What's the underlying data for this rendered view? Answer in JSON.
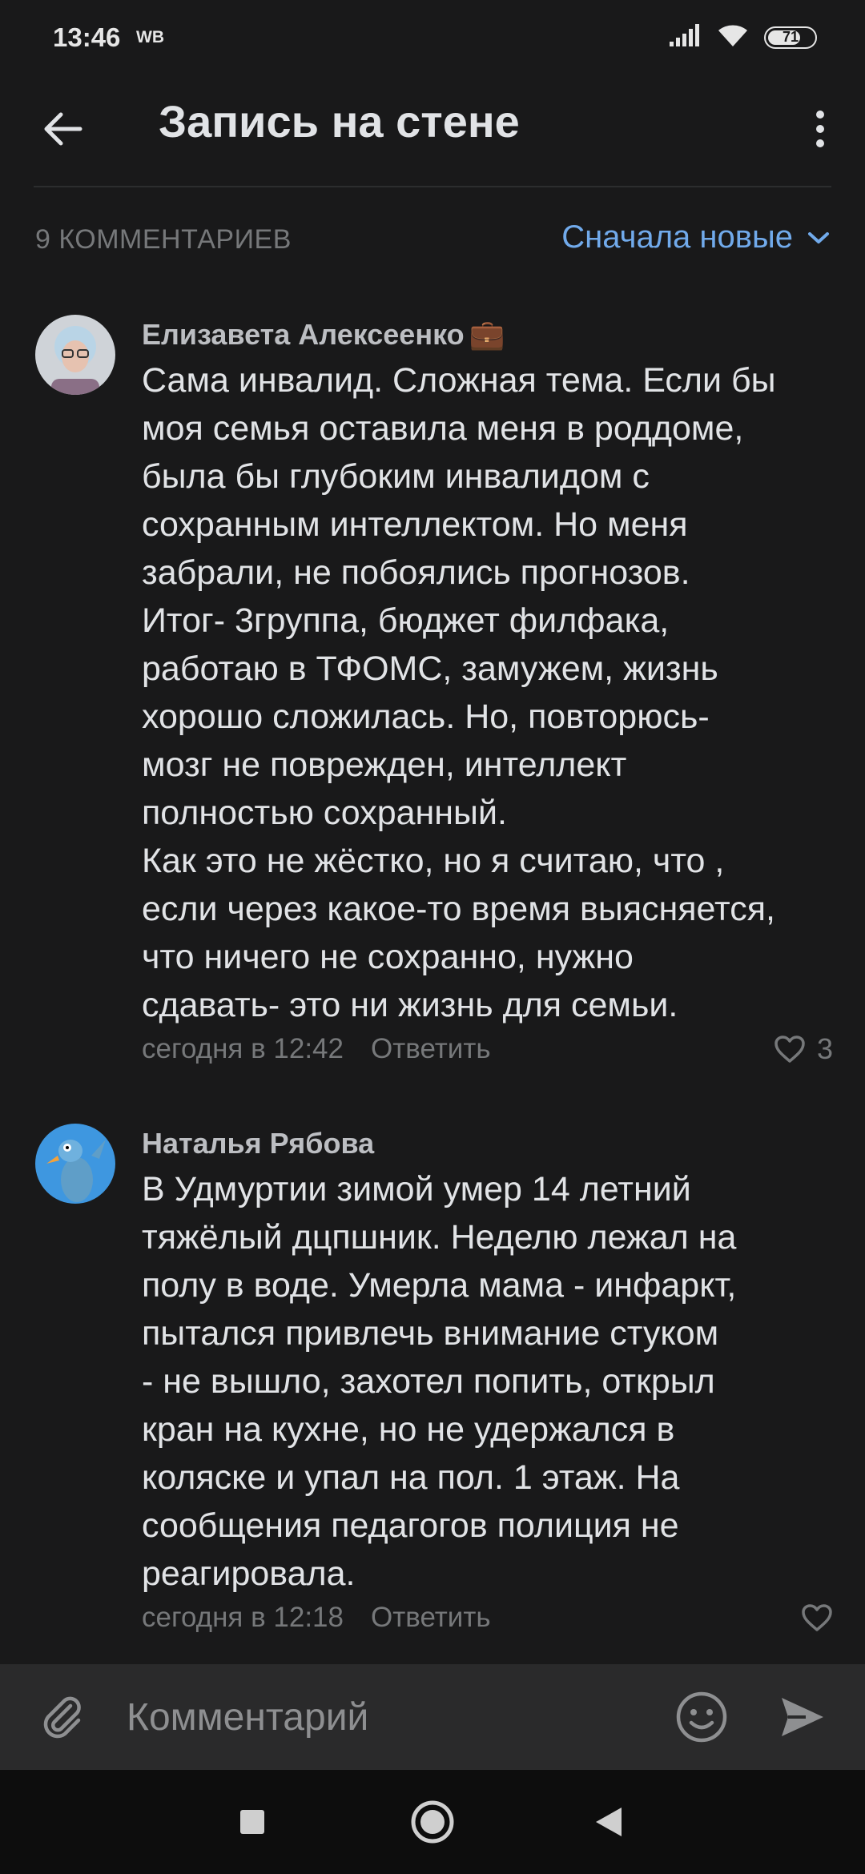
{
  "status_bar": {
    "time": "13:46",
    "carrier": "WB",
    "battery": "71",
    "battery_level": 0.71
  },
  "header": {
    "title": "Запись на стене"
  },
  "comments_bar": {
    "count_label": "9 КОММЕНТАРИЕВ",
    "sort_label": "Сначала новые"
  },
  "comments": [
    {
      "author": "Елизавета Алексеенко",
      "author_badge": "💼",
      "text": "Сама инвалид. Сложная тема. Если бы\nмоя семья оставила меня в роддоме,\nбыла бы глубоким инвалидом с\nсохранным интеллектом. Но меня\nзабрали, не побоялись прогнозов.\nИтог- 3группа, бюджет филфака,\nработаю в ТФОМС, замужем, жизнь\nхорошо сложилась. Но, повторюсь-\nмозг не поврежден, интеллект\nполностью сохранный.\nКак это не жёстко, но я считаю, что ,\nесли через какое-то время выясняется,\nчто ничего не сохранно, нужно\nсдавать- это ни жизнь для семьи.",
      "time": "сегодня в 12:42",
      "reply_label": "Ответить",
      "likes": "3"
    },
    {
      "author": "Наталья Рябова",
      "text": "В Удмуртии зимой умер 14 летний\nтяжёлый дцпшник. Неделю лежал на\nполу в воде. Умерла мама - инфаркт,\nпытался привлечь внимание стуком\n- не вышло, захотел попить, открыл\nкран на кухне, но не удержался в\nколяске и упал на пол. 1 этаж. На\nсообщения педагогов полиция не\nреагировала.",
      "time": "сегодня в 12:18",
      "reply_label": "Ответить",
      "likes": ""
    }
  ],
  "compose": {
    "placeholder": "Комментарий"
  },
  "colors": {
    "background": "#19191a",
    "accent": "#71aaeb",
    "secondary_text": "#76787a",
    "compose_bg": "#2a2a2b"
  }
}
